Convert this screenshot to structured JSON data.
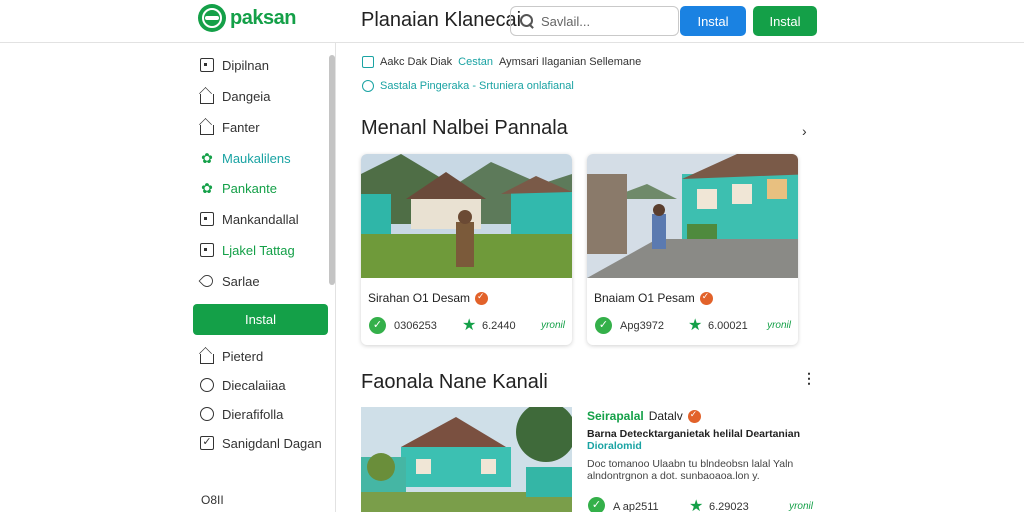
{
  "header": {
    "logo_text": "paksan",
    "title": "Planaian Klanecai",
    "search_placeholder": "Savlail...",
    "install_primary": "Instal",
    "install_secondary": "Instal"
  },
  "sidebar": {
    "items": [
      {
        "label": "Dipilnan",
        "icon": "square-icon"
      },
      {
        "label": "Dangeia",
        "icon": "house-icon"
      },
      {
        "label": "Fanter",
        "icon": "house-icon"
      },
      {
        "label": "Maukalilens",
        "icon": "leaf-icon"
      },
      {
        "label": "Pankante",
        "icon": "leaf-icon"
      },
      {
        "label": "Mankandallal",
        "icon": "square-icon"
      },
      {
        "label": "Ljakel Tattag",
        "icon": "square-icon"
      },
      {
        "label": "Sarlae",
        "icon": "tag-icon"
      }
    ],
    "install_label": "Instal",
    "items_lower": [
      {
        "label": "Pieterd",
        "icon": "house-icon"
      },
      {
        "label": "Diecalaiiaa",
        "icon": "circle-icon"
      },
      {
        "label": "Dierafifolla",
        "icon": "circle-icon"
      },
      {
        "label": "Sanigdanl Dagan",
        "icon": "check-icon"
      }
    ],
    "footer": "O8II"
  },
  "main": {
    "info1": {
      "prefix": "Aakc Dak Diak",
      "highlight": "Cestan",
      "suffix": "Aymsari Ilaganian Sellemane"
    },
    "info2": {
      "text": "Sastala Pingeraka - Srtuniera onlafianal"
    },
    "section1_title": "Menanl Nalbei Pannala",
    "cards": [
      {
        "title": "Sirahan O1 Desam",
        "stat_a": "0306253",
        "stat_b": "6.2440",
        "stat_c": "yronil"
      },
      {
        "title": "Bnaiam O1 Pesam",
        "stat_a": "Apg3972",
        "stat_b": "6.00021",
        "stat_c": "yronil"
      }
    ],
    "section2_title": "Faonala Nane Kanali",
    "feature": {
      "title_green": "Seirapalal",
      "title_rest": "Datalv",
      "subtitle": "Barna Detecktarganietak helilal Deartanian",
      "subtitle2": "Dioralomid",
      "desc": "Doc tomanoo Ulaabn tu blndeobsn lalal Yaln alndontrgnon a dot. sunbaoaoa.lon y.",
      "stat_a": "A ap2511",
      "stat_b": "6.29023",
      "stat_c": "yronil"
    }
  },
  "colors": {
    "brand_green": "#14a048",
    "accent_blue": "#1a82e2",
    "teal": "#1aa3a3"
  }
}
